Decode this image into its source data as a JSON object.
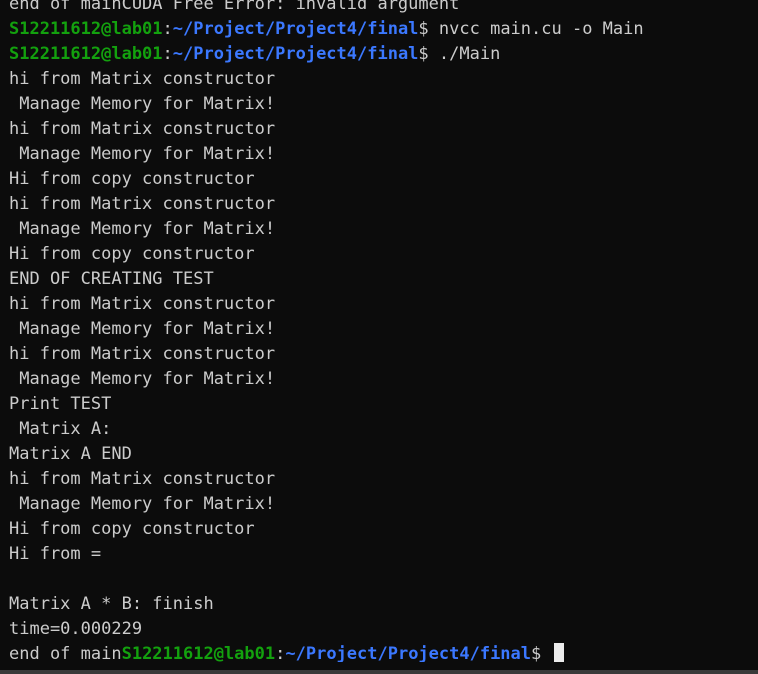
{
  "colors": {
    "background": "#0c0c0c",
    "text": "#cccccc",
    "user_host": "#13a10e",
    "path": "#3b78ff"
  },
  "lines": [
    {
      "text": "end of mainCUDA Free Error: invalid argument"
    },
    {
      "prompt": {
        "user_host": "S12211612@lab01",
        "sep": ":",
        "path": "~/Project/Project4/final",
        "symbol": "$"
      },
      "command": " nvcc main.cu -o Main"
    },
    {
      "prompt": {
        "user_host": "S12211612@lab01",
        "sep": ":",
        "path": "~/Project/Project4/final",
        "symbol": "$"
      },
      "command": " ./Main"
    },
    {
      "text": "hi from Matrix constructor"
    },
    {
      "text": " Manage Memory for Matrix!"
    },
    {
      "text": "hi from Matrix constructor"
    },
    {
      "text": " Manage Memory for Matrix!"
    },
    {
      "text": "Hi from copy constructor"
    },
    {
      "text": "hi from Matrix constructor"
    },
    {
      "text": " Manage Memory for Matrix!"
    },
    {
      "text": "Hi from copy constructor"
    },
    {
      "text": "END OF CREATING TEST"
    },
    {
      "text": "hi from Matrix constructor"
    },
    {
      "text": " Manage Memory for Matrix!"
    },
    {
      "text": "hi from Matrix constructor"
    },
    {
      "text": " Manage Memory for Matrix!"
    },
    {
      "text": "Print TEST"
    },
    {
      "text": " Matrix A:"
    },
    {
      "text": "Matrix A END"
    },
    {
      "text": "hi from Matrix constructor"
    },
    {
      "text": " Manage Memory for Matrix!"
    },
    {
      "text": "Hi from copy constructor"
    },
    {
      "text": "Hi from ="
    },
    {
      "text": ""
    },
    {
      "text": "Matrix A * B: finish"
    },
    {
      "text": "time=0.000229"
    },
    {
      "text": "end of main",
      "prompt": {
        "user_host": "S12211612@lab01",
        "sep": ":",
        "path": "~/Project/Project4/final",
        "symbol": "$"
      },
      "command": " "
    }
  ]
}
